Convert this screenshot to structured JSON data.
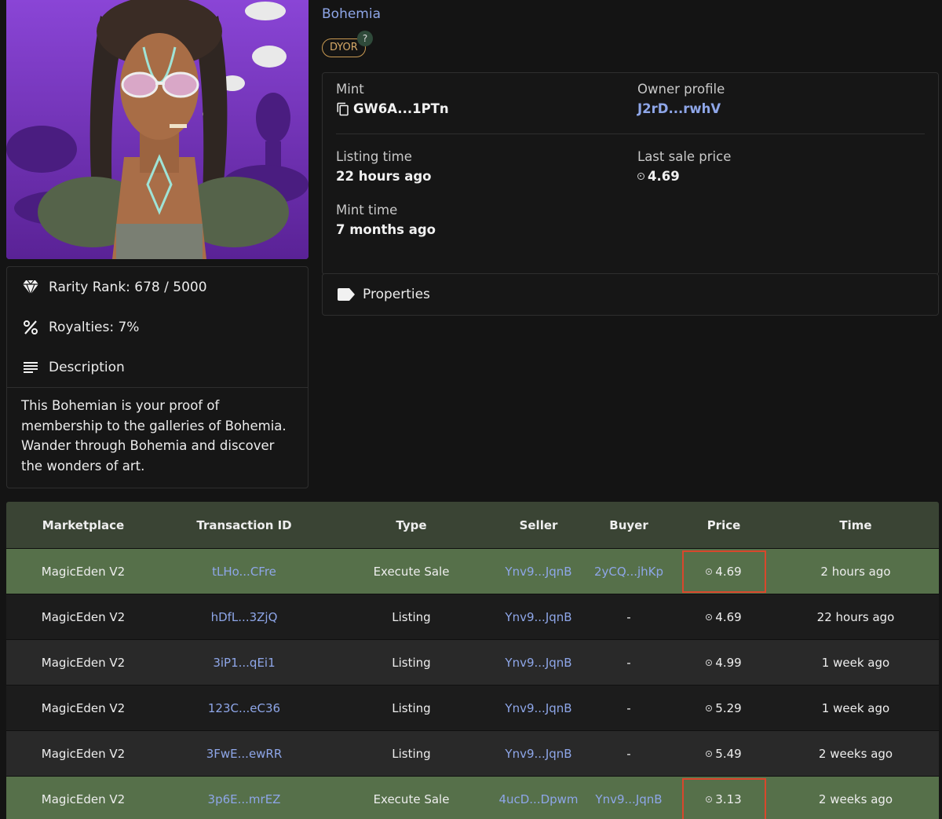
{
  "collection": {
    "name": "Bohemia",
    "badge": "DYOR",
    "help": "?"
  },
  "details": {
    "mint_label": "Mint",
    "mint_value": "GW6A...1PTn",
    "owner_label": "Owner profile",
    "owner_value": "J2rD...rwhV",
    "listing_time_label": "Listing time",
    "listing_time_value": "22 hours ago",
    "last_sale_label": "Last sale price",
    "last_sale_value": "4.69",
    "mint_time_label": "Mint time",
    "mint_time_value": "7 months ago"
  },
  "properties": {
    "label": "Properties"
  },
  "info": {
    "rarity": "Rarity Rank: 678 / 5000",
    "royalties": "Royalties: 7%",
    "description_label": "Description",
    "description": "This Bohemian is your proof of membership to the galleries of Bohemia. Wander through Bohemia and discover the wonders of art."
  },
  "table": {
    "headers": [
      "Marketplace",
      "Transaction ID",
      "Type",
      "Seller",
      "Buyer",
      "Price",
      "Time"
    ],
    "rows": [
      {
        "marketplace": "MagicEden V2",
        "tx": "tLHo...CFre",
        "type": "Execute Sale",
        "seller": "Ynv9...JqnB",
        "buyer": "2yCQ...jhKp",
        "price": "4.69",
        "time": "2 hours ago",
        "highlighted": true
      },
      {
        "marketplace": "MagicEden V2",
        "tx": "hDfL...3ZjQ",
        "type": "Listing",
        "seller": "Ynv9...JqnB",
        "buyer": "-",
        "price": "4.69",
        "time": "22 hours ago",
        "highlighted": false
      },
      {
        "marketplace": "MagicEden V2",
        "tx": "3iP1...qEi1",
        "type": "Listing",
        "seller": "Ynv9...JqnB",
        "buyer": "-",
        "price": "4.99",
        "time": "1 week ago",
        "highlighted": false
      },
      {
        "marketplace": "MagicEden V2",
        "tx": "123C...eC36",
        "type": "Listing",
        "seller": "Ynv9...JqnB",
        "buyer": "-",
        "price": "5.29",
        "time": "1 week ago",
        "highlighted": false
      },
      {
        "marketplace": "MagicEden V2",
        "tx": "3FwE...ewRR",
        "type": "Listing",
        "seller": "Ynv9...JqnB",
        "buyer": "-",
        "price": "5.49",
        "time": "2 weeks ago",
        "highlighted": false
      },
      {
        "marketplace": "MagicEden V2",
        "tx": "3p6E...mrEZ",
        "type": "Execute Sale",
        "seller": "4ucD...Dpwm",
        "buyer": "Ynv9...JqnB",
        "price": "3.13",
        "time": "2 weeks ago",
        "highlighted": true
      }
    ]
  },
  "colors": {
    "accent_link": "#8ea6e8",
    "sale_row": "#56704a",
    "highlight_border": "#d9472c",
    "badge": "#c99a52"
  }
}
